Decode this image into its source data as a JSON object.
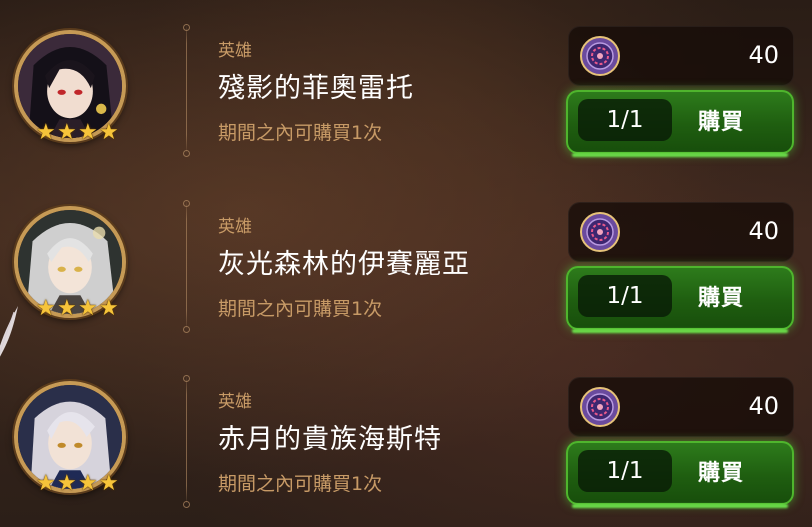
{
  "items": [
    {
      "category": "英雄",
      "name": "殘影的菲奧雷托",
      "limit_text": "期間之內可購買1次",
      "stars": "★★★★",
      "price": "40",
      "count": "1/1",
      "buy_label": "購買"
    },
    {
      "category": "英雄",
      "name": "灰光森林的伊賽麗亞",
      "limit_text": "期間之內可購買1次",
      "stars": "★★★★",
      "price": "40",
      "count": "1/1",
      "buy_label": "購買"
    },
    {
      "category": "英雄",
      "name": "赤月的貴族海斯特",
      "limit_text": "期間之內可購買1次",
      "stars": "★★★★",
      "price": "40",
      "count": "1/1",
      "buy_label": "購買"
    }
  ],
  "icons": {
    "currency": "purple-coin-icon",
    "star": "gold-star-icon"
  },
  "colors": {
    "accent_gold": "#c69a55",
    "label_tan": "#c79a66",
    "buy_green": "#2e7d1c",
    "buy_glow": "#6be14a",
    "star_gold": "#f6c43a"
  }
}
